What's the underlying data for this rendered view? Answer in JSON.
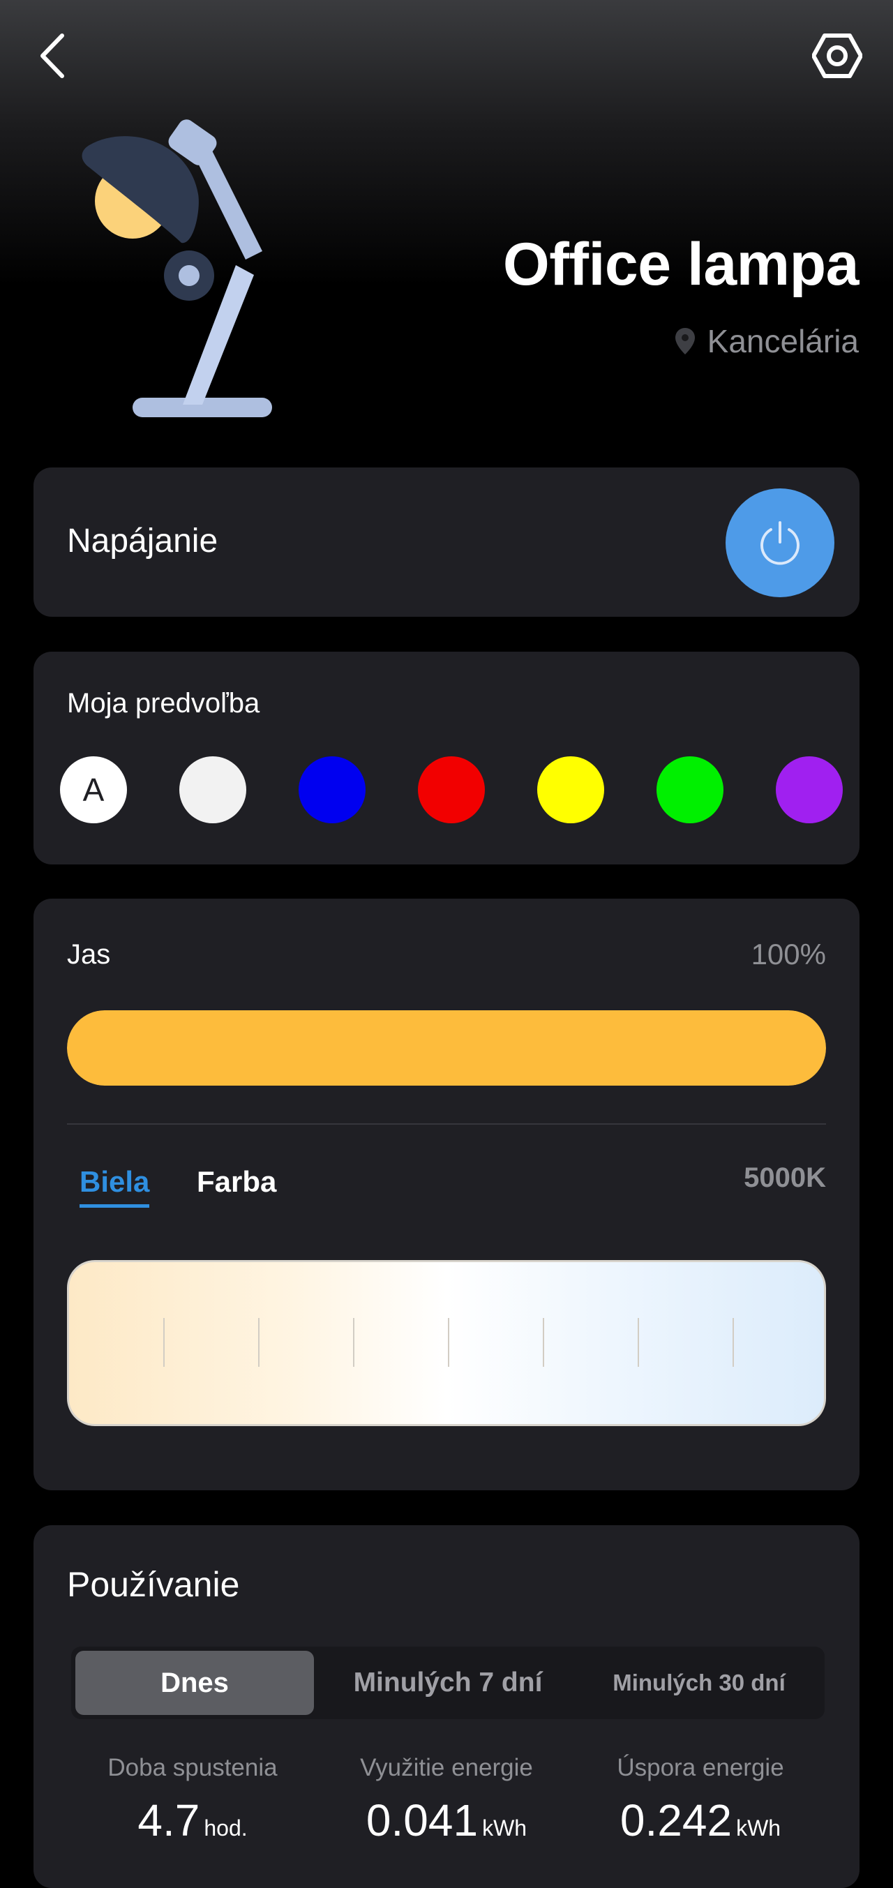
{
  "header": {
    "title": "Office lampa",
    "room": "Kancelária"
  },
  "power": {
    "label": "Napájanie",
    "state": "on",
    "button_color": "#4e9be8"
  },
  "preset": {
    "label": "Moja predvoľba",
    "auto_label": "A",
    "swatches": [
      {
        "name": "auto",
        "color": "#ffffff"
      },
      {
        "name": "white",
        "color": "#f2f2f2"
      },
      {
        "name": "blue",
        "color": "#0000f0"
      },
      {
        "name": "red",
        "color": "#f20000"
      },
      {
        "name": "yellow",
        "color": "#ffff00"
      },
      {
        "name": "green",
        "color": "#00f000"
      },
      {
        "name": "purple",
        "color": "#a020f0"
      }
    ]
  },
  "brightness": {
    "label": "Jas",
    "value_text": "100%",
    "level": 1.0,
    "color": "#fdbc3c"
  },
  "color_mode": {
    "tabs": [
      {
        "label": "Biela",
        "active": true
      },
      {
        "label": "Farba",
        "active": false
      }
    ],
    "temperature_text": "5000K",
    "accent": "#2f8fe0"
  },
  "usage": {
    "title": "Používanie",
    "periods": [
      {
        "label": "Dnes",
        "active": true
      },
      {
        "label": "Minulých 7 dní",
        "active": false
      },
      {
        "label": "Minulých 30 dní",
        "active": false
      }
    ],
    "stats": [
      {
        "label": "Doba spustenia",
        "value": "4.7",
        "unit": "hod."
      },
      {
        "label": "Využitie energie",
        "value": "0.041",
        "unit": "kWh"
      },
      {
        "label": "Úspora energie",
        "value": "0.242",
        "unit": "kWh"
      }
    ]
  }
}
